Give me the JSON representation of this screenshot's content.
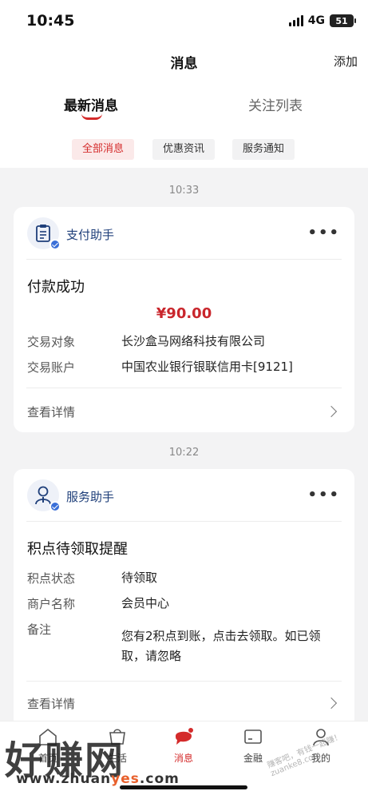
{
  "status_bar": {
    "time": "10:45",
    "network": "4G",
    "battery": "51"
  },
  "header": {
    "title": "消息",
    "add_label": "添加"
  },
  "tabs": [
    {
      "label": "最新消息"
    },
    {
      "label": "关注列表"
    }
  ],
  "filters": [
    {
      "label": "全部消息"
    },
    {
      "label": "优惠资讯"
    },
    {
      "label": "服务通知"
    }
  ],
  "messages": [
    {
      "time": "10:33",
      "sender": "支付助手",
      "title": "付款成功",
      "amount": "¥90.00",
      "rows": [
        {
          "label": "交易对象",
          "value": "长沙盒马网络科技有限公司"
        },
        {
          "label": "交易账户",
          "value": "中国农业银行银联信用卡[9121]"
        }
      ],
      "details_label": "查看详情"
    },
    {
      "time": "10:22",
      "sender": "服务助手",
      "title": "积点待领取提醒",
      "rows": [
        {
          "label": "积点状态",
          "value": "待领取"
        },
        {
          "label": "商户名称",
          "value": "会员中心"
        },
        {
          "label": "备注",
          "value": "您有2积点到账，点击去领取。如已领取，请忽略"
        }
      ],
      "details_label": "查看详情"
    }
  ],
  "bottom_nav": [
    {
      "label": "首页",
      "icon": "home-icon"
    },
    {
      "label": "生活",
      "icon": "life-icon"
    },
    {
      "label": "消息",
      "icon": "message-icon"
    },
    {
      "label": "金融",
      "icon": "finance-icon"
    },
    {
      "label": "我的",
      "icon": "profile-icon"
    }
  ],
  "watermark": {
    "text": "好赚网",
    "url_prefix": "www.zhuan",
    "url_highlight": "yes",
    "url_suffix": ".com",
    "stamp": "赚客吧，有钱一起赚！ zuanke8.com"
  },
  "colors": {
    "accent": "#d42b2b",
    "sender": "#1f3f7a",
    "verify": "#3a6fd8"
  }
}
